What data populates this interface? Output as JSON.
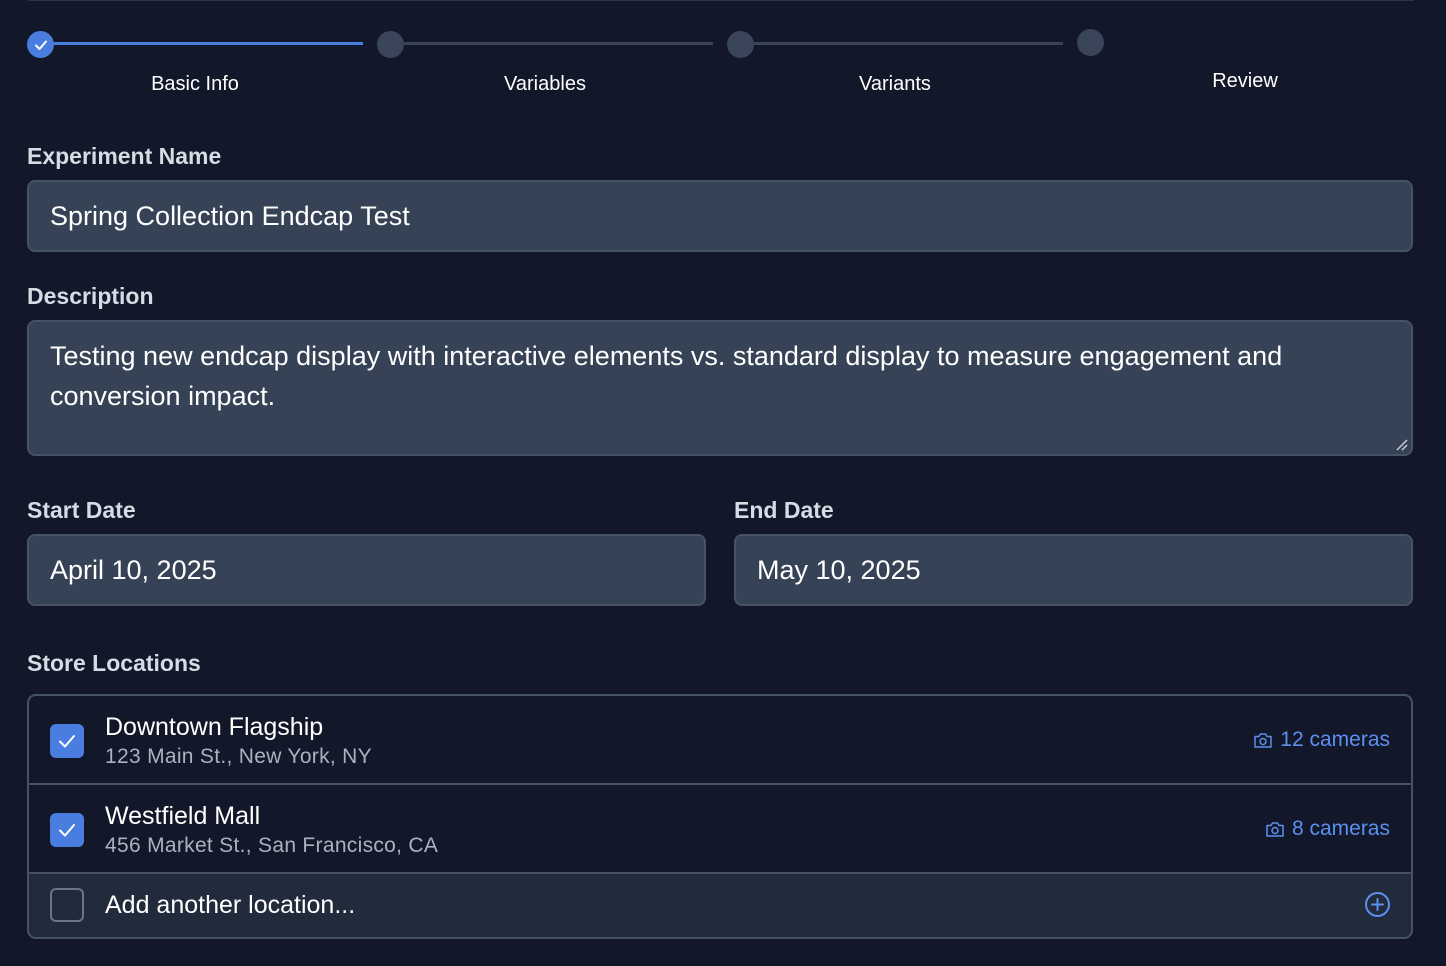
{
  "stepper": {
    "steps": [
      {
        "label": "Basic Info",
        "state": "active"
      },
      {
        "label": "Variables",
        "state": "pending"
      },
      {
        "label": "Variants",
        "state": "pending"
      },
      {
        "label": "Review",
        "state": "pending"
      }
    ],
    "active_color": "#4a7de0",
    "pending_color": "#3b4559",
    "check_icon": "check-icon"
  },
  "form": {
    "experiment_name": {
      "label": "Experiment Name",
      "value": "Spring Collection Endcap Test"
    },
    "description": {
      "label": "Description",
      "value": "Testing new endcap display with interactive elements vs. standard display to measure engagement and conversion impact."
    },
    "start_date": {
      "label": "Start Date",
      "value": "April 10, 2025"
    },
    "end_date": {
      "label": "End Date",
      "value": "May 10, 2025"
    }
  },
  "store_locations": {
    "label": "Store Locations",
    "items": [
      {
        "name": "Downtown Flagship",
        "address": "123 Main St., New York, NY",
        "cameras": "12 cameras",
        "checked": true,
        "icon": "camera-icon"
      },
      {
        "name": "Westfield Mall",
        "address": "456 Market St., San Francisco, CA",
        "cameras": "8 cameras",
        "checked": true,
        "icon": "camera-icon"
      }
    ],
    "add_location": {
      "label": "Add another location...",
      "checked": false,
      "icon": "plus-circle-icon"
    }
  },
  "colors": {
    "background": "#121829",
    "input_bg": "#364256",
    "accent": "#4a7de0",
    "link": "#5b8ff0"
  }
}
